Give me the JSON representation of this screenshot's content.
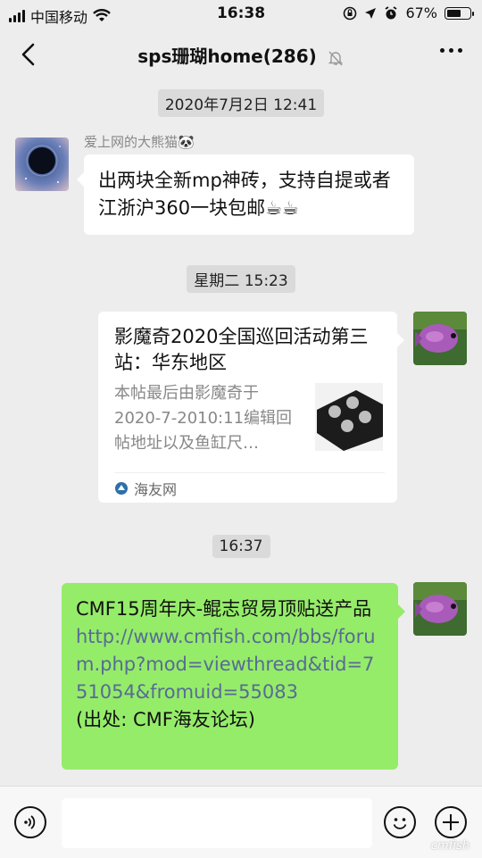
{
  "status_bar": {
    "carrier": "中国移动",
    "time": "16:38",
    "battery": "67%",
    "battery_level": 0.67
  },
  "header": {
    "title": "sps珊瑚home(286)"
  },
  "messages": [
    {
      "time": "2020年7月2日 12:41"
    },
    {
      "sender": "爱上网的大熊猫🐼",
      "text": "出两块全新mp神砖，支持自提或者江浙沪360一块包邮☕☕"
    },
    {
      "time": "星期二 15:23"
    },
    {
      "card_title": "影魔奇2020全国巡回活动第三站：华东地区",
      "card_desc": "本帖最后由影魔奇于2020-7-2010:11编辑回帖地址以及鱼缸尺…",
      "card_source": "海友网"
    },
    {
      "time": "16:37"
    },
    {
      "text": "CMF15周年庆-鲲志贸易顶贴送产品",
      "link": "http://www.cmfish.com/bbs/forum.php?mod=viewthread&tid=751054&fromuid=55083",
      "source": "(出处: CMF海友论坛)"
    }
  ],
  "watermark": "cmfish",
  "colors": {
    "background": "#ededed",
    "sent_bubble": "#95ec69",
    "link": "#576b95"
  },
  "icons": [
    "signal-icon",
    "wifi-icon",
    "lock-rotation-icon",
    "location-icon",
    "alarm-icon",
    "battery-icon",
    "back-icon",
    "mute-bell-icon",
    "more-icon",
    "voice-icon",
    "emoji-icon",
    "plus-icon"
  ]
}
